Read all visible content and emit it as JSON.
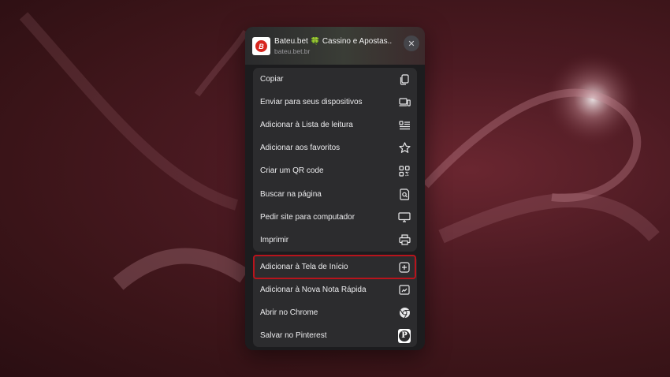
{
  "header": {
    "site_title": "Bateu.bet",
    "site_title_suffix": "Cassino e Apostas...",
    "site_url": "bateu.bet.br",
    "logo_letter": "B",
    "close_symbol": "✕"
  },
  "menu_group_1": [
    {
      "label": "Copiar",
      "icon": "copy-icon"
    },
    {
      "label": "Enviar para seus dispositivos",
      "icon": "devices-icon"
    },
    {
      "label": "Adicionar à Lista de leitura",
      "icon": "reading-list-icon"
    },
    {
      "label": "Adicionar aos favoritos",
      "icon": "star-icon"
    },
    {
      "label": "Criar um QR code",
      "icon": "qr-code-icon"
    },
    {
      "label": "Buscar na página",
      "icon": "find-in-page-icon"
    },
    {
      "label": "Pedir site para computador",
      "icon": "desktop-icon"
    },
    {
      "label": "Imprimir",
      "icon": "printer-icon"
    }
  ],
  "menu_group_2": [
    {
      "label": "Adicionar à Tela de Início",
      "icon": "add-square-icon",
      "highlighted": true
    },
    {
      "label": "Adicionar à Nova Nota Rápida",
      "icon": "quick-note-icon"
    },
    {
      "label": "Abrir no Chrome",
      "icon": "chrome-icon"
    },
    {
      "label": "Salvar no Pinterest",
      "icon": "pinterest-icon"
    }
  ],
  "pinterest_letter": "P",
  "colors": {
    "highlight_border": "#b8141c",
    "sheet_bg": "#1c1c1e",
    "group_bg": "#2c2c2e",
    "logo_red": "#d7261f"
  }
}
